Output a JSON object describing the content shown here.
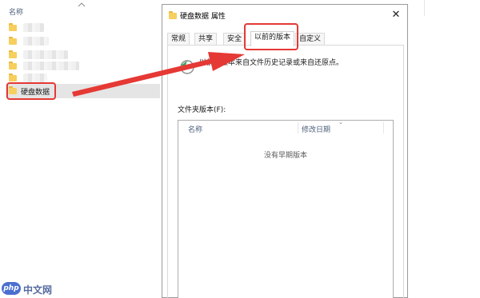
{
  "explorer": {
    "column_header": "名称",
    "items": [
      {
        "label": ""
      },
      {
        "label": ""
      },
      {
        "label": ""
      },
      {
        "label": ""
      },
      {
        "label": ""
      }
    ],
    "selected_item": {
      "label": "硬盘数据"
    }
  },
  "dialog": {
    "title": "硬盘数据 属性",
    "close_symbol": "✕",
    "tabs": [
      {
        "label": "常规"
      },
      {
        "label": "共享"
      },
      {
        "label": "安全"
      },
      {
        "label": "以前的版本",
        "active": true
      },
      {
        "label": "自定义"
      }
    ],
    "info_text": "以前的版本来自文件历史记录或来自还原点。",
    "versions_label": "文件夹版本(F):",
    "list_columns": [
      "名称",
      "修改日期"
    ],
    "empty_text": "没有早期版本"
  },
  "watermark": {
    "logo_text": "php",
    "site_text": "中文网"
  },
  "colors": {
    "annotation_red": "#e53935",
    "folder_yellow": "#f7cf5e",
    "selection_gray": "#e5e5e5"
  }
}
